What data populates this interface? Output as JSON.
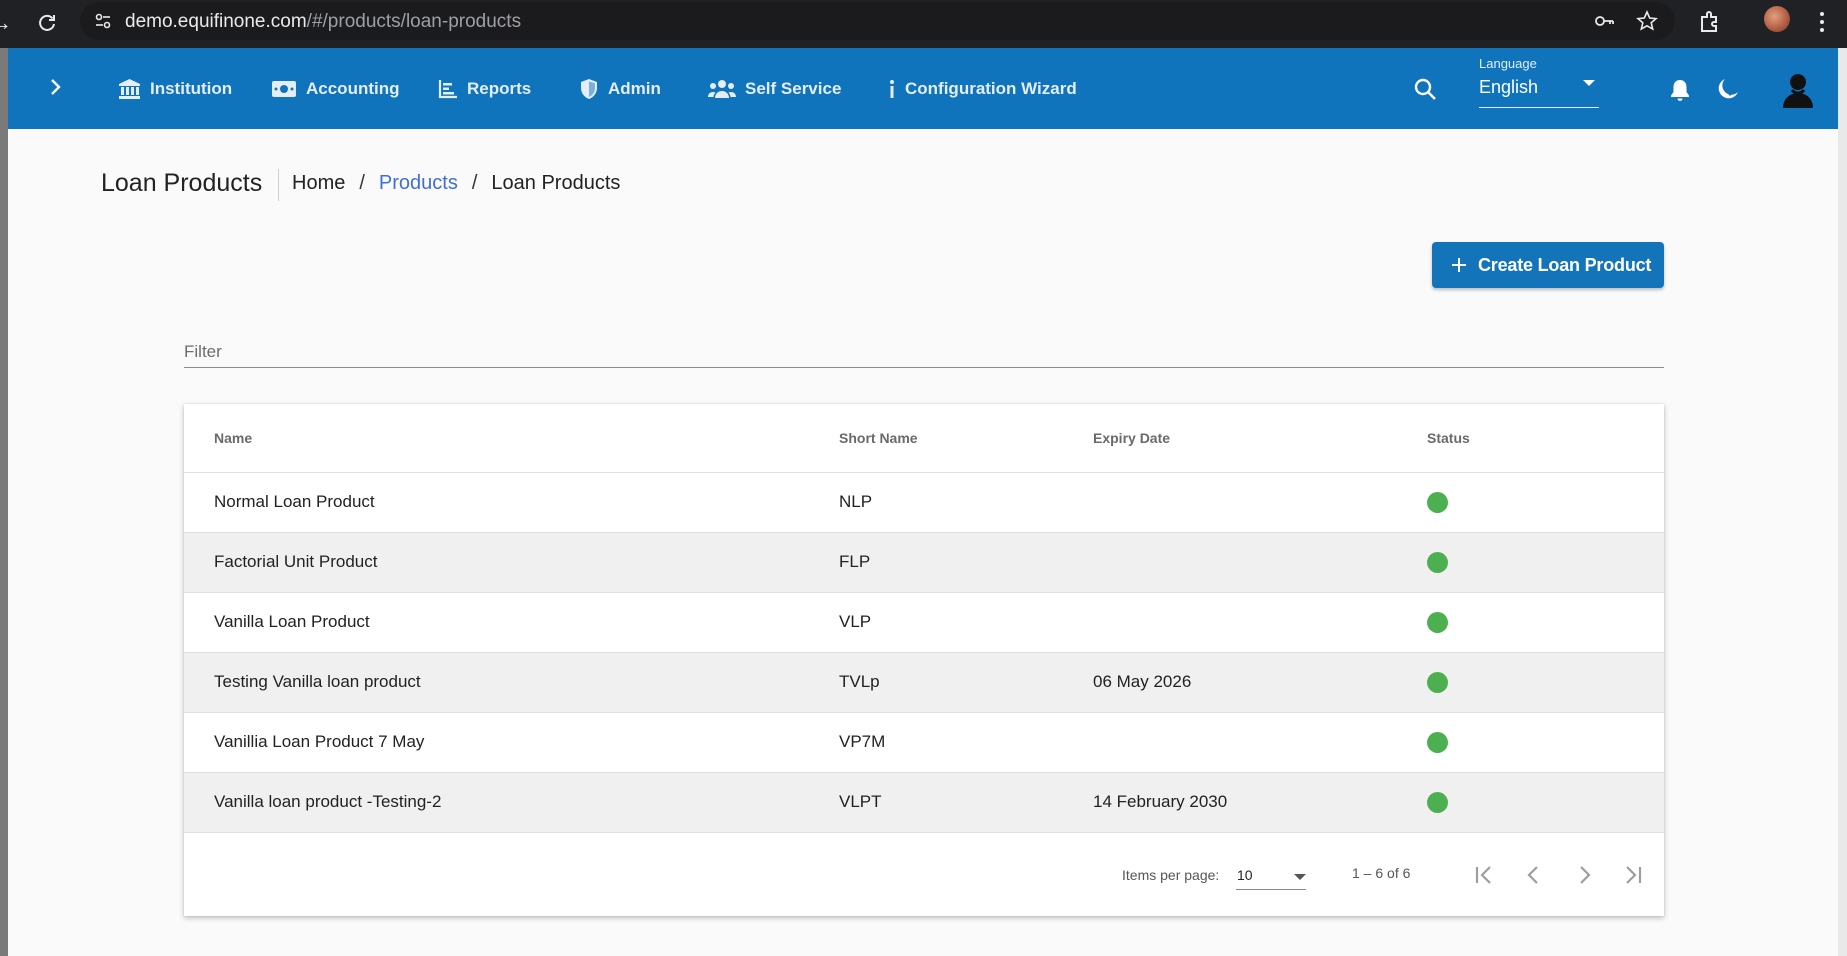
{
  "browser": {
    "url_host": "demo.equifinone.com",
    "url_path": "/#/products/loan-products"
  },
  "toolbar": {
    "menu": [
      {
        "label": "Institution",
        "icon": "bank-icon"
      },
      {
        "label": "Accounting",
        "icon": "money-icon"
      },
      {
        "label": "Reports",
        "icon": "chart-icon"
      },
      {
        "label": "Admin",
        "icon": "shield-icon"
      },
      {
        "label": "Self Service",
        "icon": "users-icon"
      },
      {
        "label": "Configuration Wizard",
        "icon": "info-icon"
      }
    ],
    "language_label": "Language",
    "language_value": "English",
    "colors": {
      "bar": "#1074bc",
      "text": "#e3eef8"
    }
  },
  "page": {
    "title": "Loan Products",
    "breadcrumb": {
      "home": "Home",
      "sep1": "/",
      "products": "Products",
      "sep2": "/",
      "current": "Loan Products"
    },
    "create_button": "Create Loan Product",
    "filter_placeholder": "Filter"
  },
  "table": {
    "headers": {
      "name": "Name",
      "short_name": "Short Name",
      "expiry_date": "Expiry Date",
      "status": "Status"
    },
    "rows": [
      {
        "name": "Normal Loan Product",
        "short_name": "NLP",
        "expiry_date": "",
        "status": "active"
      },
      {
        "name": "Factorial Unit Product",
        "short_name": "FLP",
        "expiry_date": "",
        "status": "active"
      },
      {
        "name": "Vanilla Loan Product",
        "short_name": "VLP",
        "expiry_date": "",
        "status": "active"
      },
      {
        "name": "Testing Vanilla loan product",
        "short_name": "TVLp",
        "expiry_date": "06 May 2026",
        "status": "active"
      },
      {
        "name": "Vanillia Loan Product 7 May",
        "short_name": "VP7M",
        "expiry_date": "",
        "status": "active"
      },
      {
        "name": "Vanilla loan product -Testing-2",
        "short_name": "VLPT",
        "expiry_date": "14 February 2030",
        "status": "active"
      }
    ],
    "status_color": "#4caf50"
  },
  "paginator": {
    "items_per_page_label": "Items per page:",
    "items_per_page_value": "10",
    "range_label": "1 – 6 of 6"
  }
}
